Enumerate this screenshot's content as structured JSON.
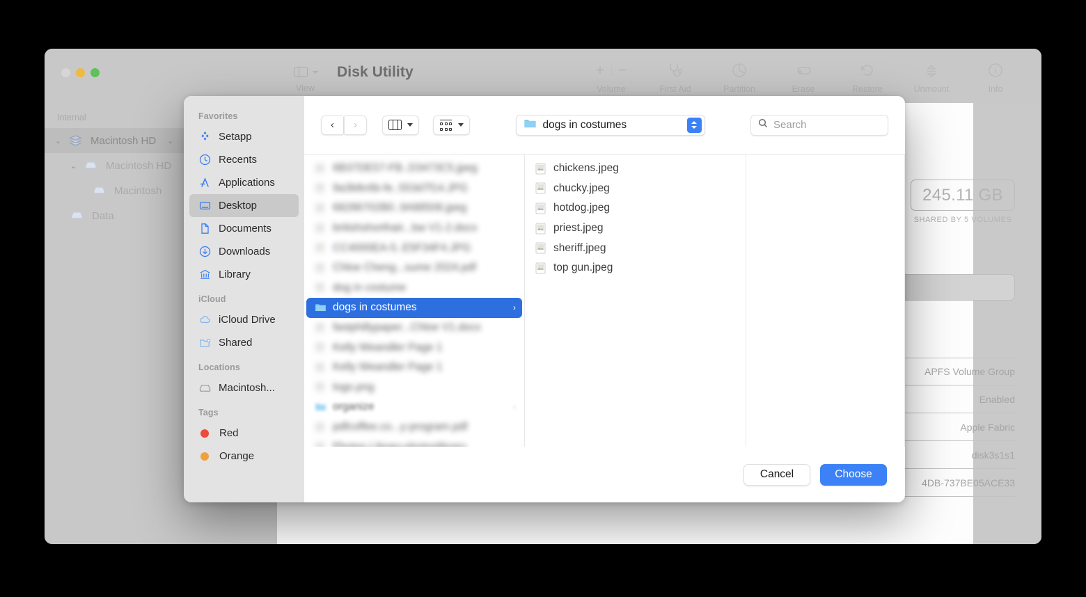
{
  "background_window": {
    "title": "Disk Utility",
    "view_label": "View",
    "traffic_lights": [
      "close-disabled",
      "minimize",
      "zoom"
    ],
    "toolbar": [
      {
        "id": "volume",
        "label": "Volume",
        "icon": "plus-minus-icon"
      },
      {
        "id": "first-aid",
        "label": "First Aid",
        "icon": "stethoscope-icon"
      },
      {
        "id": "partition",
        "label": "Partition",
        "icon": "pie-chart-icon"
      },
      {
        "id": "erase",
        "label": "Erase",
        "icon": "erase-disk-icon"
      },
      {
        "id": "restore",
        "label": "Restore",
        "icon": "restore-arrow-icon"
      },
      {
        "id": "unmount",
        "label": "Unmount",
        "icon": "unmount-eject-icon"
      },
      {
        "id": "info",
        "label": "Info",
        "icon": "info-circle-icon"
      }
    ],
    "sidebar": {
      "group": "Internal",
      "items": [
        {
          "label": "Macintosh HD",
          "icon": "disk-stack-icon",
          "indent": 0,
          "expanded": true,
          "selected": true
        },
        {
          "label": "Macintosh HD",
          "icon": "volume-icon",
          "indent": 1,
          "expanded": true,
          "selected": false
        },
        {
          "label": "Macintosh",
          "icon": "volume-icon",
          "indent": 2,
          "expanded": false,
          "selected": false
        },
        {
          "label": "Data",
          "icon": "volume-icon",
          "indent": 1,
          "expanded": false,
          "selected": false
        }
      ]
    },
    "capacity": {
      "value": "245.11 GB",
      "subtitle": "SHARED BY 5 VOLUMES"
    },
    "details": [
      "APFS Volume Group",
      "Enabled",
      "Apple Fabric",
      "disk3s1s1",
      "4DB-737BE05ACE33"
    ]
  },
  "dialog": {
    "sidebar": {
      "groups": [
        {
          "title": "Favorites",
          "items": [
            {
              "label": "Setapp",
              "icon": "setapp-icon",
              "selected": false
            },
            {
              "label": "Recents",
              "icon": "clock-icon",
              "selected": false
            },
            {
              "label": "Applications",
              "icon": "applications-icon",
              "selected": false
            },
            {
              "label": "Desktop",
              "icon": "desktop-icon",
              "selected": true
            },
            {
              "label": "Documents",
              "icon": "document-icon",
              "selected": false
            },
            {
              "label": "Downloads",
              "icon": "download-icon",
              "selected": false
            },
            {
              "label": "Library",
              "icon": "library-icon",
              "selected": false
            }
          ]
        },
        {
          "title": "iCloud",
          "items": [
            {
              "label": "iCloud Drive",
              "icon": "cloud-icon",
              "selected": false
            },
            {
              "label": "Shared",
              "icon": "shared-folder-icon",
              "selected": false
            }
          ]
        },
        {
          "title": "Locations",
          "items": [
            {
              "label": "Macintosh...",
              "icon": "hard-drive-icon",
              "selected": false
            }
          ]
        },
        {
          "title": "Tags",
          "items": [
            {
              "label": "Red",
              "icon": "tag-dot-icon",
              "color": "#ec4a3b",
              "selected": false
            },
            {
              "label": "Orange",
              "icon": "tag-dot-icon",
              "color": "#f0a13a",
              "selected": false
            }
          ]
        }
      ]
    },
    "toolbar": {
      "back_icon": "chevron-left-icon",
      "forward_icon": "chevron-right-icon",
      "view_mode_icon": "column-view-icon",
      "group_by_icon": "group-by-icon",
      "path_popup": {
        "icon": "folder-icon",
        "name": "dogs in costumes"
      },
      "search": {
        "icon": "search-icon",
        "placeholder": "Search",
        "value": ""
      }
    },
    "columns": [
      {
        "id": "column-1",
        "items": [
          {
            "name": "6B37DE57-FB..D3473C5.jpeg",
            "kind": "file",
            "icon": "image-file-icon",
            "blurred": true,
            "selected": false,
            "has_chevron": false
          },
          {
            "name": "9a3b8c6b-fe..553d7f14.JPG",
            "kind": "file",
            "icon": "image-file-icon",
            "blurred": true,
            "selected": false,
            "has_chevron": false
          },
          {
            "name": "68286702B0..9A88506.jpeg",
            "kind": "file",
            "icon": "image-file-icon",
            "blurred": true,
            "selected": false,
            "has_chevron": false
          },
          {
            "name": "britishshorthair...bw V1-2.docx",
            "kind": "file",
            "icon": "word-doc-icon",
            "blurred": true,
            "selected": false,
            "has_chevron": false
          },
          {
            "name": "CC4000EA-5..E5F34F4.JPG",
            "kind": "file",
            "icon": "image-file-icon",
            "blurred": true,
            "selected": false,
            "has_chevron": false
          },
          {
            "name": "Chloe Cheng...sume 2024.pdf",
            "kind": "file",
            "icon": "pdf-file-icon",
            "blurred": true,
            "selected": false,
            "has_chevron": false
          },
          {
            "name": "dog in costume",
            "kind": "file",
            "icon": "image-file-icon",
            "blurred": true,
            "selected": false,
            "has_chevron": false
          },
          {
            "name": "dogs in costumes",
            "kind": "folder",
            "icon": "folder-icon",
            "blurred": false,
            "selected": true,
            "has_chevron": true
          },
          {
            "name": "fastphillypaper...Chloe V1.docx",
            "kind": "file",
            "icon": "word-doc-icon",
            "blurred": true,
            "selected": false,
            "has_chevron": false
          },
          {
            "name": "Kelly Weandler Page 1",
            "kind": "file",
            "icon": "pdf-file-icon",
            "blurred": true,
            "selected": false,
            "has_chevron": false
          },
          {
            "name": "Kelly Weandler Page 1",
            "kind": "file",
            "icon": "page-file-icon",
            "blurred": true,
            "selected": false,
            "has_chevron": false
          },
          {
            "name": "logo.png",
            "kind": "file",
            "icon": "image-file-icon",
            "blurred": true,
            "selected": false,
            "has_chevron": false
          },
          {
            "name": "organize",
            "kind": "folder",
            "icon": "folder-icon",
            "blurred": true,
            "selected": false,
            "has_chevron": true
          },
          {
            "name": "pdfcoffee.co...y-program.pdf",
            "kind": "file",
            "icon": "pdf-file-icon",
            "blurred": true,
            "selected": false,
            "has_chevron": false
          },
          {
            "name": "Photos Library.photoslibrary",
            "kind": "file",
            "icon": "photos-icon",
            "blurred": true,
            "selected": false,
            "has_chevron": false
          }
        ]
      },
      {
        "id": "column-2",
        "items": [
          {
            "name": "chickens.jpeg",
            "kind": "file",
            "icon": "image-file-icon",
            "blurred": false,
            "selected": false,
            "has_chevron": false
          },
          {
            "name": "chucky.jpeg",
            "kind": "file",
            "icon": "image-file-icon",
            "blurred": false,
            "selected": false,
            "has_chevron": false
          },
          {
            "name": "hotdog.jpeg",
            "kind": "file",
            "icon": "image-file-icon",
            "blurred": false,
            "selected": false,
            "has_chevron": false
          },
          {
            "name": "priest.jpeg",
            "kind": "file",
            "icon": "image-file-icon",
            "blurred": false,
            "selected": false,
            "has_chevron": false
          },
          {
            "name": "sheriff.jpeg",
            "kind": "file",
            "icon": "image-file-icon",
            "blurred": false,
            "selected": false,
            "has_chevron": false
          },
          {
            "name": "top gun.jpeg",
            "kind": "file",
            "icon": "image-file-icon",
            "blurred": false,
            "selected": false,
            "has_chevron": false
          }
        ]
      },
      {
        "id": "column-3",
        "items": []
      }
    ],
    "footer": {
      "cancel_label": "Cancel",
      "choose_label": "Choose"
    }
  },
  "colors": {
    "selection_blue": "#2e6fe0",
    "accent_blue": "#3c82f6",
    "sidebar_bg": "#e3e3e3",
    "window_bg": "#c9c9c9",
    "tag_red": "#ec4a3b"
  }
}
